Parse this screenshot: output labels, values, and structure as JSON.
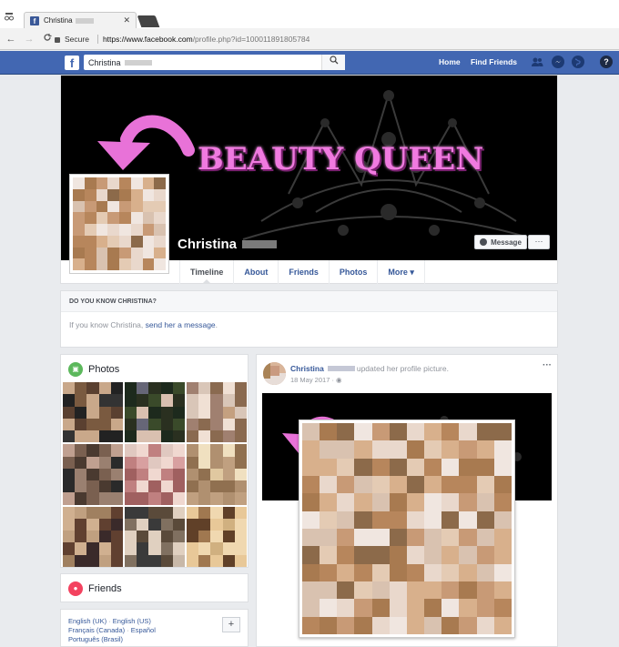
{
  "browser": {
    "tab_title": "Christina",
    "tab_close": "✕",
    "nav_back": "←",
    "nav_forward": "→",
    "nav_reload": "C",
    "secure_label": "Secure",
    "url_scheme_host": "https://www.facebook.com",
    "url_path": "/profile.php?id=100011891805784"
  },
  "header": {
    "logo": "f",
    "search_value": "Christina",
    "search_icon": "search-icon",
    "nav_home": "Home",
    "nav_find_friends": "Find Friends",
    "icons": [
      "friends-icon",
      "messenger-icon",
      "globe-icon",
      "help-icon"
    ],
    "help_glyph": "?",
    "brand_color": "#4267b2"
  },
  "cover": {
    "overlay_text": "BEAUTY  QUEEN",
    "profile_name": "Christina",
    "message_button": "Message",
    "more_button": "···"
  },
  "tabs": [
    {
      "label": "Timeline"
    },
    {
      "label": "About"
    },
    {
      "label": "Friends"
    },
    {
      "label": "Photos"
    },
    {
      "label": "More ▾"
    }
  ],
  "know": {
    "header": "DO YOU KNOW CHRISTINA?",
    "text": "If you know Christina, ",
    "link": "send her a message",
    "suffix": "."
  },
  "photos_card": {
    "title": "Photos",
    "icon": "photos-icon"
  },
  "friends_card": {
    "title": "Friends",
    "icon": "friends-icon"
  },
  "languages": {
    "line1_a": "English (UK)",
    "line1_b": "English (US)",
    "line2_a": "Français (Canada)",
    "line2_b": "Español",
    "line3": "Português (Brasil)",
    "add_button": "+"
  },
  "post": {
    "author": "Christina",
    "action": "updated her profile picture.",
    "date": "18 May 2017 · ",
    "menu": "···"
  }
}
